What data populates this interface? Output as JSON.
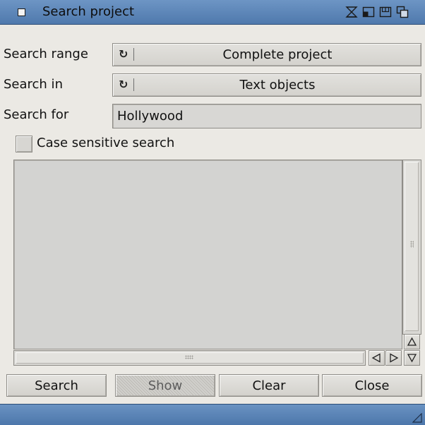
{
  "window": {
    "title": "Search project",
    "title_icons": [
      "close-gadget-icon",
      "iconify-icon",
      "zoom-icon",
      "snapshot-icon",
      "depth-icon"
    ]
  },
  "form": {
    "search_range": {
      "label": "Search range",
      "value": "Complete project"
    },
    "search_in": {
      "label": "Search in",
      "value": "Text objects"
    },
    "search_for": {
      "label": "Search for",
      "value": "Hollywood"
    },
    "case_sensitive": {
      "label": "Case sensitive search",
      "checked": false
    }
  },
  "results": {
    "items": []
  },
  "buttons": {
    "search": "Search",
    "show": "Show",
    "clear": "Clear",
    "close": "Close"
  },
  "colors": {
    "titlebar": "#5a82b5",
    "window_bg": "#ebe9e4",
    "list_bg": "#d3d3d1"
  }
}
